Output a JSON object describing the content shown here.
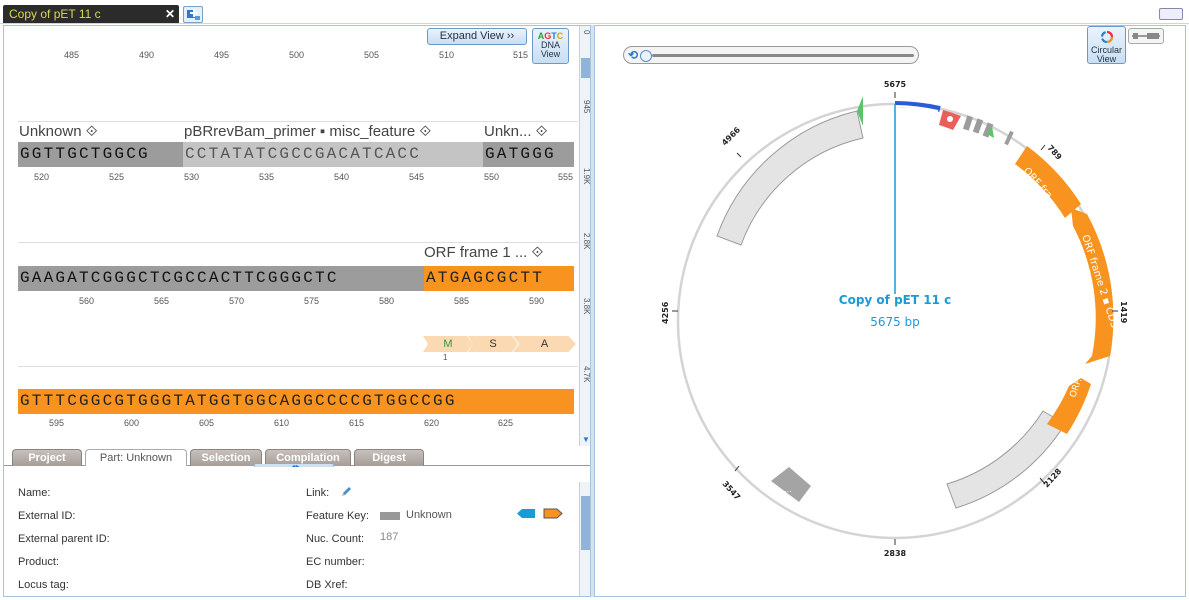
{
  "doc_tab": {
    "title": "Copy of pET 11 c",
    "close": "✕"
  },
  "seq": {
    "expand_label": "Expand View  ››",
    "dna_agtc": "AGTC",
    "dna_label": "DNA View",
    "top_ruler": [
      "485",
      "490",
      "495",
      "500",
      "505",
      "510",
      "515"
    ],
    "rows": [
      {
        "labels": [
          "Unknown ⟐",
          "pBRrevBam_primer ▪ misc_feature ⟐",
          "Unkn... ⟐"
        ],
        "segments": [
          "GGTTGCTGGCG",
          "CCTATATCGCCGACATCACC",
          "GATGGG"
        ],
        "ruler": [
          "520",
          "525",
          "530",
          "535",
          "540",
          "545",
          "550",
          "555"
        ]
      },
      {
        "labels": [
          "ORF frame 1 ... ⟐"
        ],
        "segments": [
          "GAAGATCGGGCTCGCCACTTCGGGCTC",
          "ATGAGCGCTT"
        ],
        "ruler": [
          "560",
          "565",
          "570",
          "575",
          "580",
          "585",
          "590"
        ],
        "aa": [
          "M",
          "S",
          "A"
        ],
        "aa_index": "1"
      },
      {
        "segments": [
          "GTTTCGGCGTGGGTATGGTGGCAGGCCCCGTGGCCGG"
        ],
        "ruler": [
          "595",
          "600",
          "605",
          "610",
          "615",
          "620",
          "625"
        ]
      }
    ],
    "scroll_labels": [
      "0",
      "945",
      "1.9K",
      "2.8K",
      "3.8K",
      "4.7K"
    ]
  },
  "inspector": {
    "tabs": [
      "Project",
      "Part: Unknown",
      "Selection",
      "Compilation",
      "Digest"
    ],
    "info": "i",
    "left_fields": [
      "Name:",
      "External ID:",
      "External parent ID:",
      "Product:",
      "Locus tag:"
    ],
    "right_fields": [
      "Link:",
      "Feature Key:",
      "Nuc. Count:",
      "EC number:",
      "DB Xref:"
    ],
    "feature_key_value": "Unknown",
    "nuc_count_value": "187"
  },
  "map": {
    "circular_label": "Circular View",
    "name": "Copy of pET 11 c",
    "length": "5675 bp",
    "ticks": [
      "5675",
      "789",
      "1419",
      "2128",
      "2838",
      "3547",
      "4256",
      "4966"
    ],
    "features": [
      "ORF fra...",
      "ORF frame 2 ▪ CDS",
      "ORF...",
      "..."
    ],
    "colors": {
      "orf": "#f7931e",
      "gray": "#dcdcdc",
      "blue": "#1a9bd7",
      "primer": "#2a5bd8",
      "red": "#e9605a",
      "green": "#5bc46a"
    }
  }
}
